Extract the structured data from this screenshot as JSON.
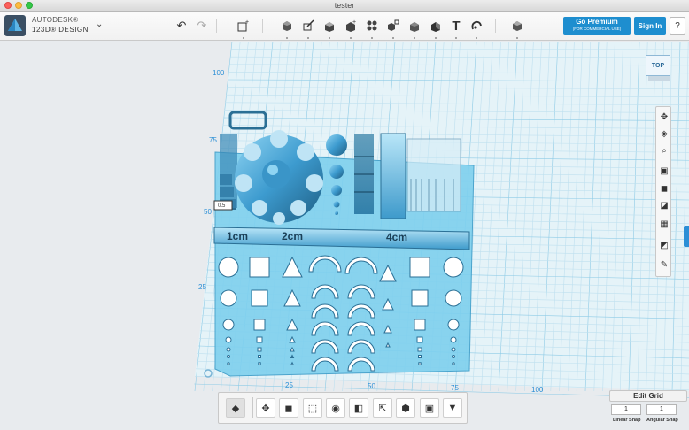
{
  "window": {
    "title": "tester"
  },
  "app": {
    "brand": "AUTODESK®",
    "product": "123D® DESIGN"
  },
  "toolbar": {
    "left_icons": [
      "undo-icon",
      "redo-icon",
      "new-sketch-icon"
    ],
    "tool_icons": [
      "primitives-icon",
      "sketch-icon",
      "construct-icon",
      "modify-icon",
      "pattern-icon",
      "group-icon",
      "combine-icon",
      "measure-icon",
      "text-icon",
      "snap-icon",
      "material-icon"
    ],
    "premium_label": "Go Premium",
    "premium_sub": "(FOR COMMERCIAL USE)",
    "signin_label": "Sign In",
    "help_label": "?"
  },
  "viewcube": {
    "label": "TOP"
  },
  "grid": {
    "y_labels": [
      "100",
      "75",
      "50",
      "25"
    ],
    "x_labels": [
      "25",
      "50",
      "75",
      "100"
    ]
  },
  "model": {
    "ruler_labels": [
      "1cm",
      "2cm",
      "4cm"
    ],
    "small_tag": "0.5"
  },
  "nav_icons": [
    "pan-icon",
    "orbit-icon",
    "zoom-icon",
    "fit-icon",
    "view-icon",
    "shade-icon",
    "materials-icon",
    "snap-grid-icon",
    "edit-icon"
  ],
  "bottom_toolbar": [
    "move-view-icon",
    "transform-icon",
    "extrude-icon",
    "scale-icon",
    "visibility-icon",
    "solid-icon",
    "export-icon",
    "mesh-icon",
    "smart-scale-icon",
    "shell-icon"
  ],
  "edit_grid": {
    "button_label": "Edit Grid",
    "linear_value": "1",
    "angular_value": "1",
    "linear_label": "Linear Snap",
    "angular_label": "Angular Snap"
  },
  "colors": {
    "accent": "#1e8ecf",
    "grid_line": "#bfe0ef",
    "model_face": "#6bc3e8",
    "model_dark": "#2a6f95"
  }
}
